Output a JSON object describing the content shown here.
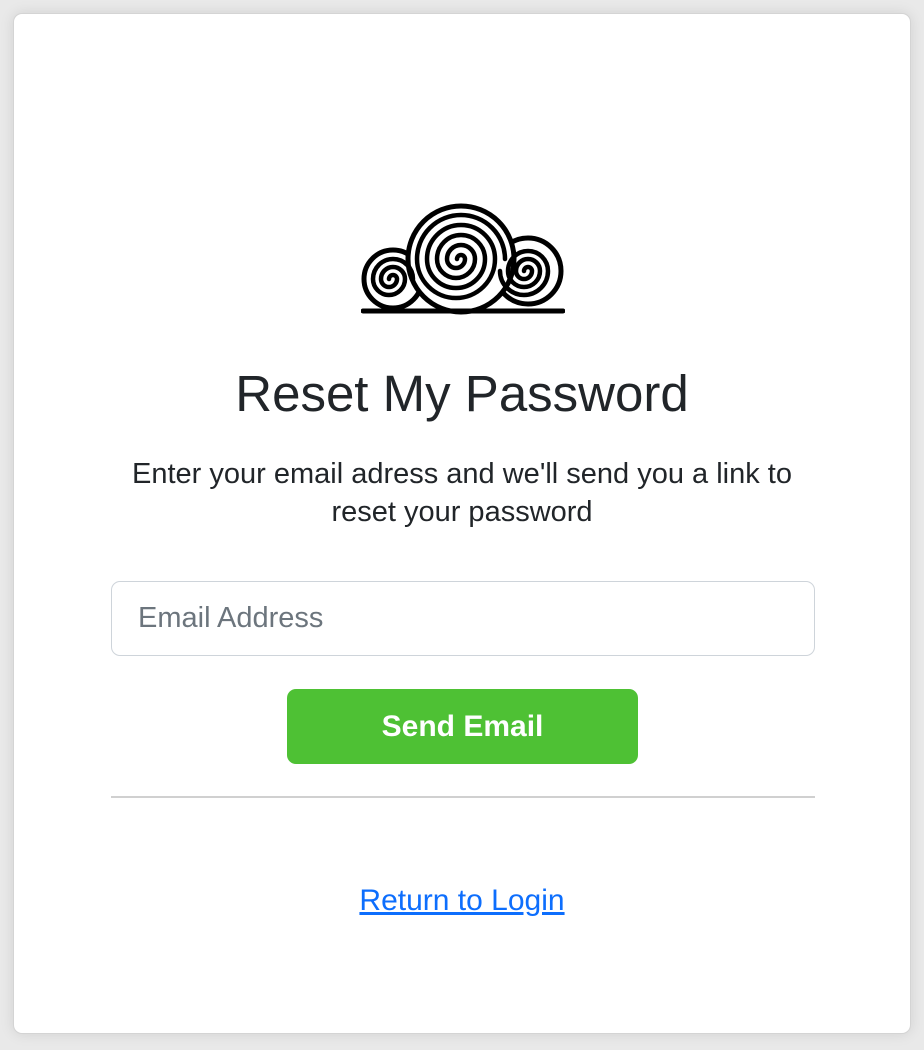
{
  "logo": {
    "icon": "hay-bales-logo-icon"
  },
  "title": "Reset My Password",
  "subtitle": "Enter your email adress and we'll send you a link to reset your password",
  "email_field": {
    "placeholder": "Email Address",
    "value": ""
  },
  "send_button": {
    "label": "Send Email"
  },
  "return_link": {
    "label": "Return to Login"
  },
  "colors": {
    "accent_green": "#4ec134",
    "link_blue": "#0d6efd",
    "text_dark": "#212529",
    "placeholder_gray": "#6c757d"
  }
}
